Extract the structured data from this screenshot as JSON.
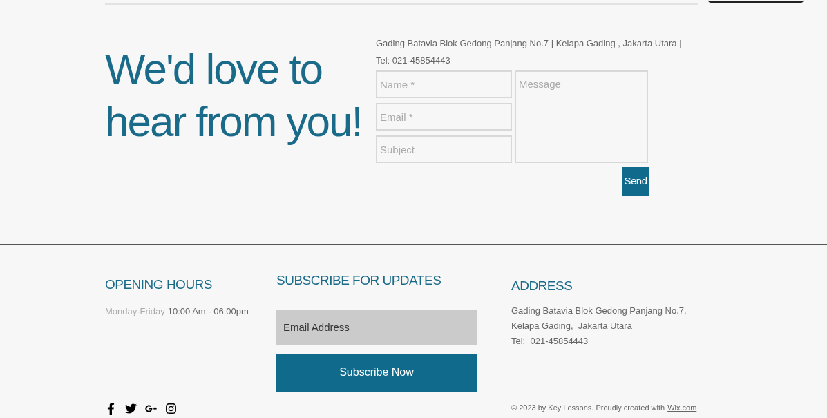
{
  "contact": {
    "heading_lines": [
      "We'd love to",
      "hear from you!"
    ],
    "address_line": "Gading Batavia Blok Gedong Panjang No.7 | Kelapa Gading , Jakarta Utara |",
    "phone": "Tel:  021-45854443",
    "fields": [
      {
        "placeholder": "Name *"
      },
      {
        "placeholder": "Email *"
      },
      {
        "placeholder": "Subject"
      }
    ],
    "message": {
      "placeholder": "Message"
    },
    "send_button": "Send"
  },
  "footer": {
    "opening_hours": {
      "title": "OPENING HOURS",
      "days": "Monday-Friday",
      "hours": "10:00 Am - 06:00pm"
    },
    "subscribe": {
      "title": "SUBSCRIBE FOR UPDATES",
      "email": {
        "placeholder": "Email Address"
      },
      "button": "Subscribe Now"
    },
    "address": {
      "title": "ADDRESS",
      "lines": [
        "Gading Batavia Blok Gedong Panjang No.7,",
        "Kelapa Gading,  Jakarta Utara",
        "Tel:  021-45854443"
      ]
    },
    "social": [
      {
        "kind": "facebook"
      },
      {
        "kind": "twitter"
      },
      {
        "kind": "googleplus"
      },
      {
        "kind": "instagram"
      }
    ],
    "copyright": "© 2023 by Key Lessons. Proudly created with",
    "copyright_link": "Wix.com"
  }
}
